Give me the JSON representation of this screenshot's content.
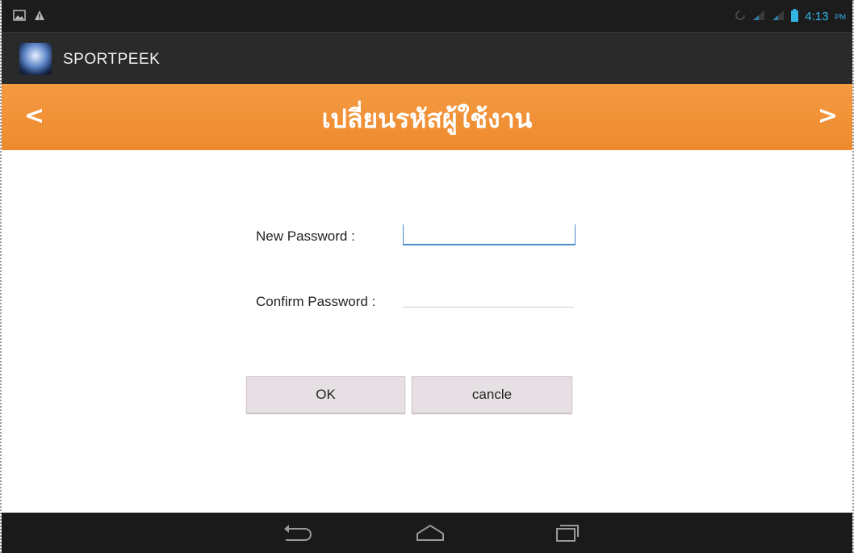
{
  "status_bar": {
    "time": "4:13",
    "time_suffix": "PM",
    "left_icons": [
      "image-notification-icon",
      "warning-icon"
    ],
    "right_icons": [
      "sync-icon",
      "signal-icon",
      "signal-icon",
      "battery-icon"
    ]
  },
  "action_bar": {
    "app_name": "SPORTPEEK"
  },
  "header": {
    "title": "เปลี่ยนรหัสผู้ใช้งาน",
    "prev_label": "<",
    "next_label": ">",
    "color": "#f0902f"
  },
  "form": {
    "new_password_label": "New Password :",
    "confirm_password_label": "Confirm Password :",
    "new_password_value": "",
    "confirm_password_value": ""
  },
  "buttons": {
    "ok_label": "OK",
    "cancel_label": "cancle"
  },
  "nav_bar": {
    "icons": [
      "back-icon",
      "home-icon",
      "recent-apps-icon"
    ]
  }
}
